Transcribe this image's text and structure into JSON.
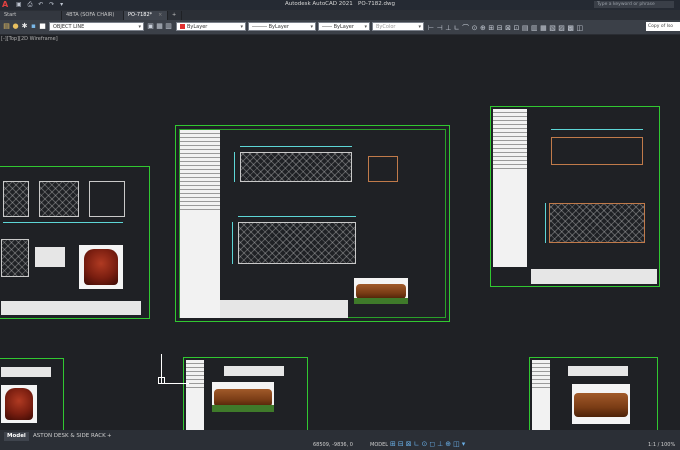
{
  "app": {
    "logo": "A",
    "title": "Autodesk AutoCAD 2021",
    "filename": "PO-7182.dwg",
    "search_placeholder": "Type a keyword or phrase"
  },
  "tabs": [
    {
      "label": "Start"
    },
    {
      "label": "4BTA (SOFA CHAIR)"
    },
    {
      "label": "PO-7182*"
    }
  ],
  "ribbon": {
    "layer": "OBJECT LINE",
    "color": "ByLayer",
    "linetype": "ByLayer",
    "lineweight": "ByLayer",
    "plotstyle": "ByColor",
    "copy_of": "Copy of Iso"
  },
  "view_label": "[-][Top][2D Wireframe]",
  "layout_tabs": [
    {
      "label": "Model"
    },
    {
      "label": "ASTON DESK & SIDE RACK"
    }
  ],
  "status": {
    "coordinates": "68509, -9836, 0",
    "space": "MODEL",
    "scale": "1:1 / 100%"
  },
  "colors": {
    "sheet_border": "#31c831",
    "dimension": "#5dd6d6",
    "background": "#1f2125"
  }
}
